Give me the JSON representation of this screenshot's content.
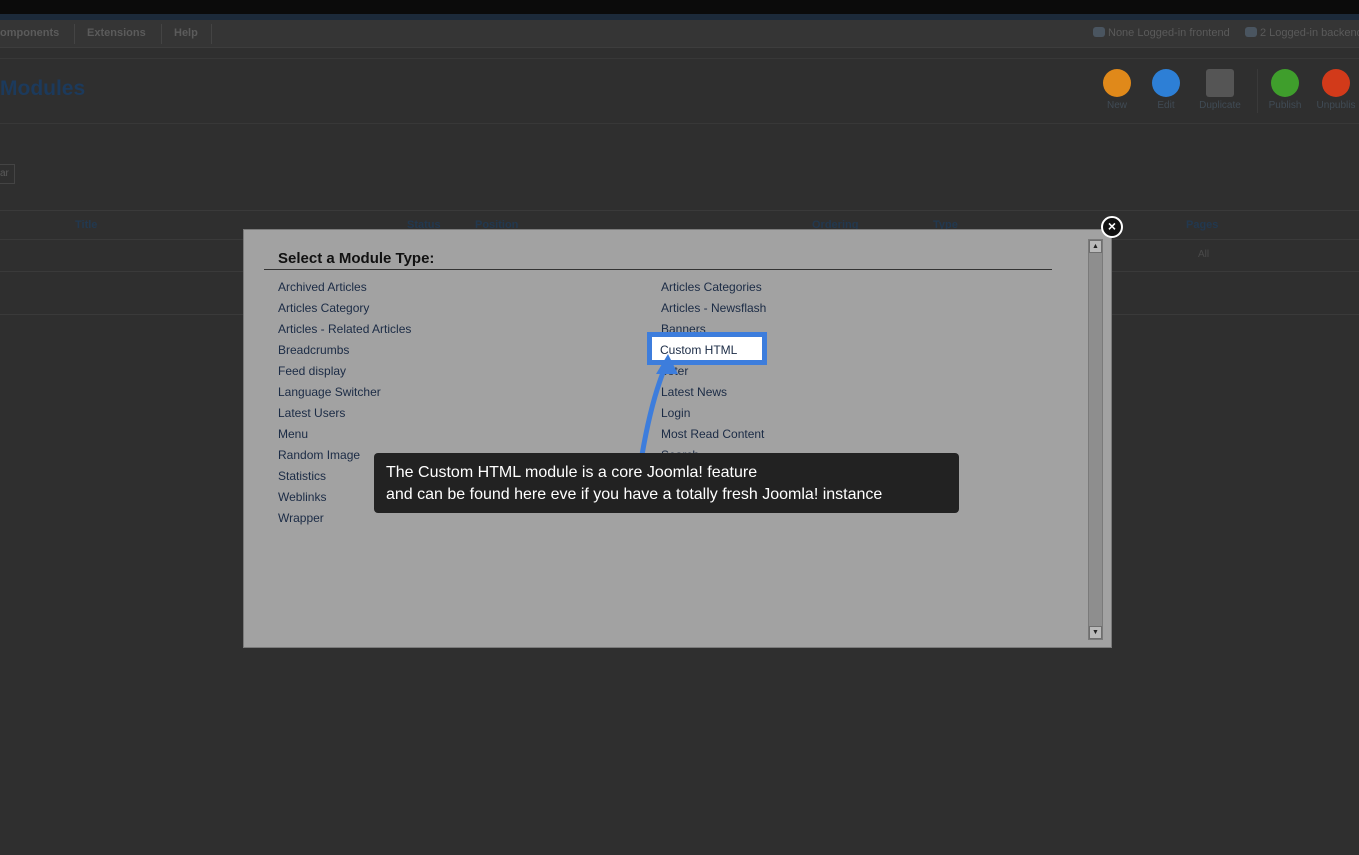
{
  "menubar": {
    "items": [
      "omponents",
      "Extensions",
      "Help"
    ],
    "status": {
      "frontend": "None Logged-in frontend",
      "backend": "2 Logged-in backend"
    }
  },
  "header": {
    "title": "Modules",
    "toolbar": [
      {
        "label": "New",
        "icon": "plus-circle-icon",
        "color": "#e0891a"
      },
      {
        "label": "Edit",
        "icon": "pencil-circle-icon",
        "color": "#2d7fd6"
      },
      {
        "label": "Duplicate",
        "icon": "duplicate-icon",
        "color": "#8a8a8a"
      },
      {
        "label": "Publish",
        "icon": "check-circle-icon",
        "color": "#3f9e2c"
      },
      {
        "label": "Unpublis",
        "icon": "unpublish-circle-icon",
        "color": "#d23a1a"
      }
    ]
  },
  "filter": {
    "clear_label": "ar"
  },
  "table": {
    "columns": [
      "Title",
      "Status",
      "Position",
      "Ordering",
      "Type",
      "Pages"
    ],
    "row1_pages": "All"
  },
  "modal": {
    "title": "Select a Module Type:",
    "left_column": [
      "Archived Articles",
      "Articles Category",
      "Articles - Related Articles",
      "Breadcrumbs",
      "Feed display",
      "Language Switcher",
      "Latest Users",
      "Menu",
      "Random Image",
      "Statistics",
      "Weblinks",
      "Wrapper"
    ],
    "right_column": [
      "Articles Categories",
      "Articles - Newsflash",
      "Banners",
      "Custom HTML",
      "ooter",
      "Latest News",
      "Login",
      "Most Read Content",
      "Search"
    ],
    "highlighted": "Custom HTML"
  },
  "callout": {
    "line1": "The Custom HTML module is a core Joomla! feature",
    "line2": "and can be found here eve if you have a totally fresh Joomla! instance"
  },
  "colors": {
    "highlight": "#3d7ddc",
    "callout_bg": "#222222",
    "modal_bg": "#a2a2a2"
  }
}
